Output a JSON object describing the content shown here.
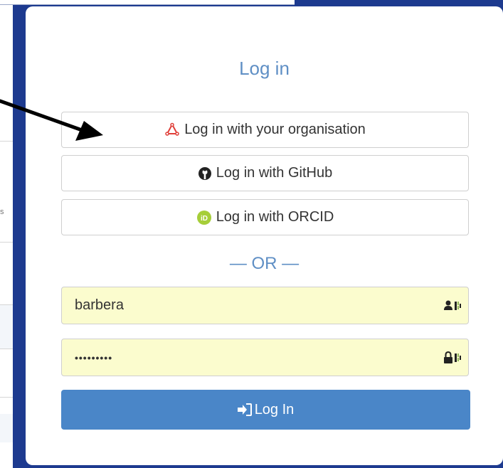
{
  "modal": {
    "title": "Log in",
    "sso_buttons": [
      {
        "label": "Log in with your organisation",
        "icon": "organisation-icon"
      },
      {
        "label": "Log in with GitHub",
        "icon": "github-icon"
      },
      {
        "label": "Log in with ORCID",
        "icon": "orcid-icon"
      }
    ],
    "separator": "— OR —",
    "username": {
      "value": "barbera"
    },
    "password": {
      "value": "•••••••••"
    },
    "login_button": {
      "label": "Log In",
      "icon": "sign-in-icon"
    }
  },
  "background": {
    "fragment_text": "s"
  },
  "colors": {
    "accent": "#5f8fc5",
    "primary_button": "#4a86c8",
    "autofill": "#fbfcce",
    "frame": "#1d3a8f"
  }
}
